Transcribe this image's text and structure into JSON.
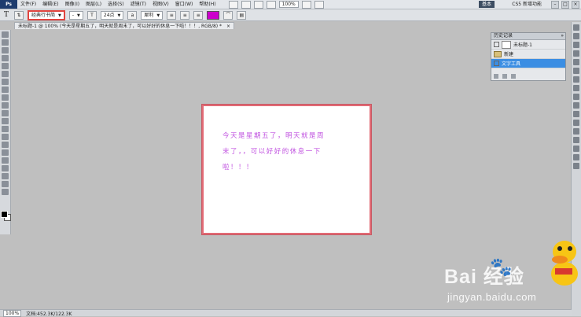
{
  "menubar": {
    "logo": "Ps",
    "items": [
      "文件(F)",
      "编辑(E)",
      "图像(I)",
      "图层(L)",
      "选择(S)",
      "滤镜(T)",
      "视图(V)",
      "窗口(W)",
      "帮助(H)"
    ],
    "zoom": "100%",
    "workspace": "基本",
    "cs_live": "CS5 新增功能",
    "window_controls": [
      "–",
      "□",
      "×"
    ]
  },
  "options": {
    "tool_glyph": "T",
    "font_family": "经典行书简",
    "font_style": "-",
    "font_size": "24点",
    "antialias": "犀利"
  },
  "document": {
    "tab_title": "未标题-1 @ 100% (今天是星期五了，明天就是周末了，可以好好的休息一下啦！！！, RGB/8) *",
    "close_glyph": "×"
  },
  "layers_panel": {
    "title": "历史记录",
    "close_glyph": "»",
    "rows": [
      {
        "label": "未标题-1",
        "selected": false
      },
      {
        "label": "新建",
        "selected": false
      },
      {
        "label": "文字工具",
        "selected": true
      }
    ]
  },
  "canvas": {
    "lines": [
      "今天是星期五了，明天就是周",
      "末了，，可以好好的休息一下",
      "啦！！！"
    ]
  },
  "statusbar": {
    "zoom": "100%",
    "doc_info": "文档:452.3K/122.3K"
  },
  "watermark": {
    "brand": "Bai  经验",
    "paw": "🐾",
    "url": "jingyan.baidu.com"
  },
  "colors": {
    "text_color": "#cc00cc",
    "selection": "#3b8ee3",
    "highlight": "#e0443e"
  }
}
